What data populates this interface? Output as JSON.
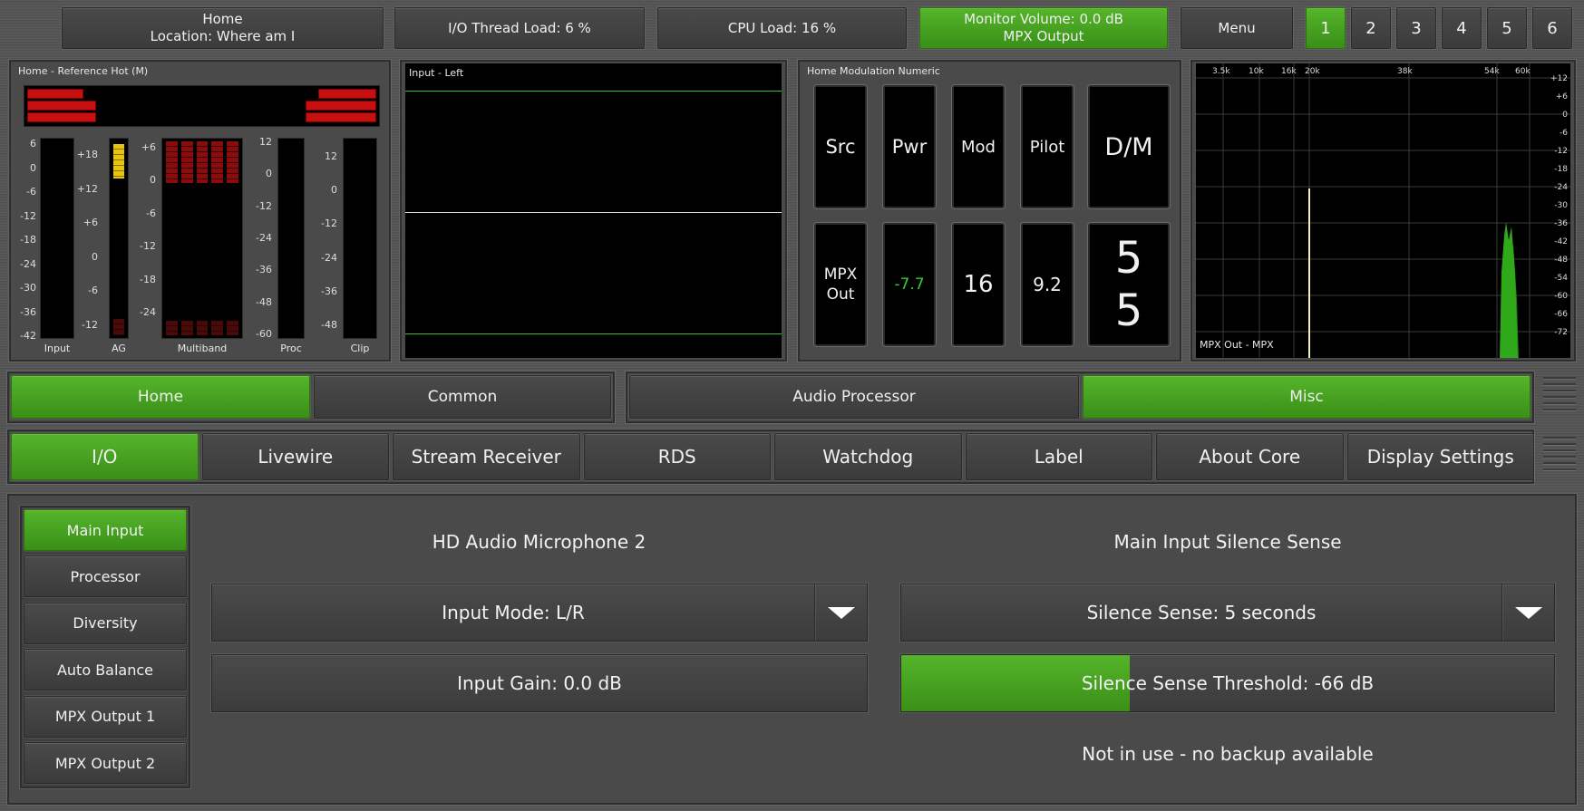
{
  "topbar": {
    "home_line1": "Home",
    "home_line2": "Location: Where am I",
    "io_load": "I/O Thread Load: 6 %",
    "cpu_load": "CPU Load: 16 %",
    "monitor_line1": "Monitor Volume: 0.0 dB",
    "monitor_line2": "MPX Output",
    "menu": "Menu",
    "presets": [
      "1",
      "2",
      "3",
      "4",
      "5",
      "6"
    ],
    "active_preset": "1"
  },
  "meters_panel": {
    "title": "Home - Reference Hot (M)",
    "input_scale": [
      "6",
      "0",
      "-6",
      "-12",
      "-18",
      "-24",
      "-30",
      "-36",
      "-42"
    ],
    "ag_scale": [
      "+18",
      "+12",
      "+6",
      "0",
      "-6",
      "-12"
    ],
    "mb_scale": [
      "+6",
      "0",
      "-6",
      "-12",
      "-18",
      "-24"
    ],
    "proc_scale": [
      "12",
      "0",
      "-12",
      "-24",
      "-36",
      "-48",
      "-60"
    ],
    "clip_scale": [
      "12",
      "0",
      "-12",
      "-24",
      "-36",
      "-48"
    ],
    "labels": {
      "input": "Input",
      "ag": "AG",
      "multiband": "Multiband",
      "proc": "Proc",
      "clip": "Clip"
    }
  },
  "scope_panel": {
    "title": "Input - Left"
  },
  "numeric_panel": {
    "title": "Home Modulation Numeric",
    "headers": [
      "Src",
      "Pwr",
      "Mod",
      "Pilot",
      "D/M"
    ],
    "src_value": "MPX Out",
    "pwr_value": "-7.7",
    "mod_value": "16",
    "pilot_value": "9.2",
    "dm_value_top": "5",
    "dm_value_bottom": "5"
  },
  "spectrum_panel": {
    "title": "MPX Out - MPX",
    "freq_labels": [
      "3.5k",
      "10k",
      "16k",
      "20k",
      "38k",
      "54k",
      "60k"
    ],
    "db_labels": [
      "+12",
      "+6",
      "0",
      "-6",
      "-12",
      "-18",
      "-24",
      "-30",
      "-36",
      "-42",
      "-48",
      "-54",
      "-60",
      "-66",
      "-72"
    ]
  },
  "nav_primary": {
    "items": [
      "Home",
      "Common",
      "Audio Processor",
      "Misc"
    ],
    "active": [
      "Home",
      "Misc"
    ]
  },
  "nav_secondary": {
    "items": [
      "I/O",
      "Livewire",
      "Stream Receiver",
      "RDS",
      "Watchdog",
      "Label",
      "About Core",
      "Display Settings"
    ],
    "active": "I/O"
  },
  "sidebar": {
    "items": [
      "Main Input",
      "Processor",
      "Diversity",
      "Auto Balance",
      "MPX Output 1",
      "MPX Output 2"
    ],
    "active": "Main Input"
  },
  "main": {
    "device_name": "HD Audio Microphone 2",
    "silence_title": "Main Input Silence Sense",
    "input_mode": "Input Mode: L/R",
    "input_gain": "Input Gain: 0.0 dB",
    "silence_sense": "Silence Sense: 5 seconds",
    "silence_threshold": "Silence Sense Threshold: -66 dB",
    "silence_threshold_fill": 0.35,
    "backup_status": "Not in use - no backup available"
  },
  "colors": {
    "accent_green": "#4aa322",
    "meter_red": "#c81010",
    "meter_yellow": "#e8c40a",
    "spectrum_green": "#2fa81a"
  }
}
